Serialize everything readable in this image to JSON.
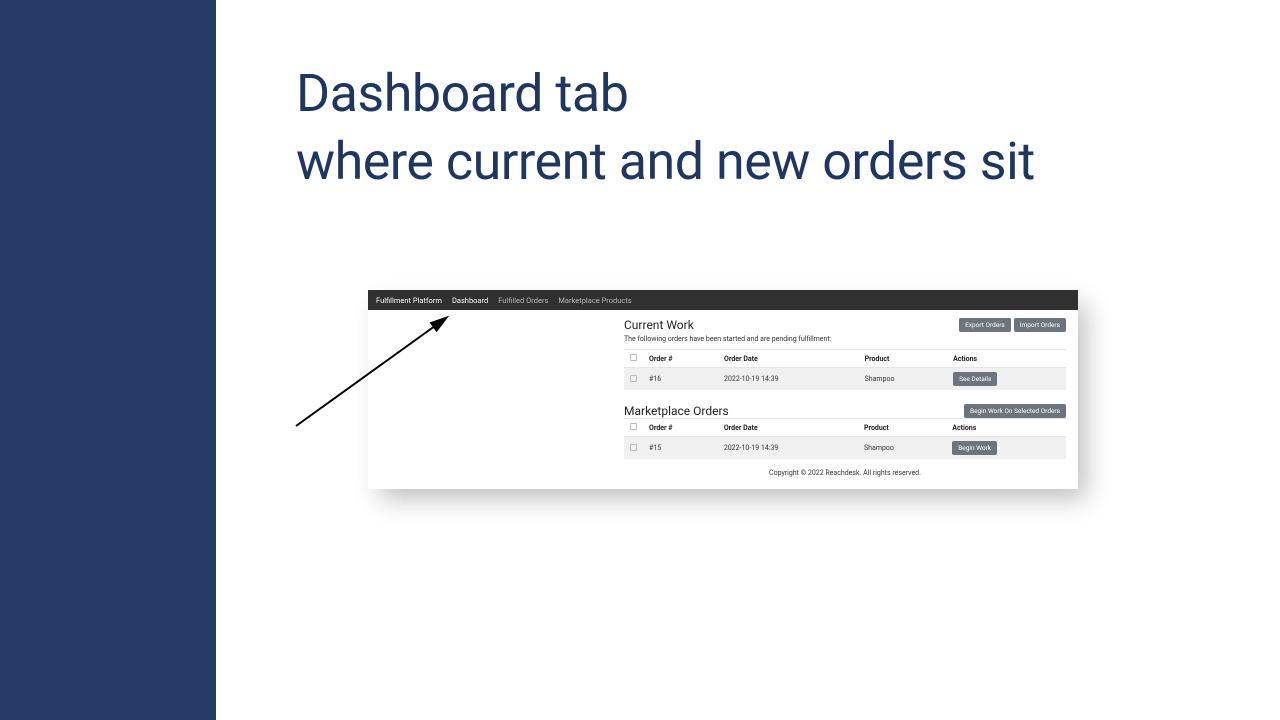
{
  "headline_line1": "Dashboard tab",
  "headline_line2": "where current and new orders sit",
  "nav": {
    "brand": "Fulfillment Platform",
    "dashboard": "Dashboard",
    "fulfilled": "Fulfilled Orders",
    "marketplace": "Marketplace Products"
  },
  "current": {
    "title": "Current Work",
    "desc": "The following orders have been started and are pending fulfillment:",
    "export_btn": "Export Orders",
    "import_btn": "Import Orders",
    "headers": {
      "order": "Order #",
      "date": "Order Date",
      "product": "Product",
      "actions": "Actions"
    },
    "row": {
      "order": "#16",
      "date": "2022-10-19 14:39",
      "product": "Shampoo",
      "action": "See Details"
    }
  },
  "marketplace": {
    "title": "Marketplace Orders",
    "begin_selected_btn": "Begin Work On Selected Orders",
    "headers": {
      "order": "Order #",
      "date": "Order Date",
      "product": "Product",
      "actions": "Actions"
    },
    "row": {
      "order": "#15",
      "date": "2022-10-19 14:39",
      "product": "Shampoo",
      "action": "Begin Work"
    }
  },
  "footer": "Copyright © 2022 Reachdesk. All rights reserved."
}
